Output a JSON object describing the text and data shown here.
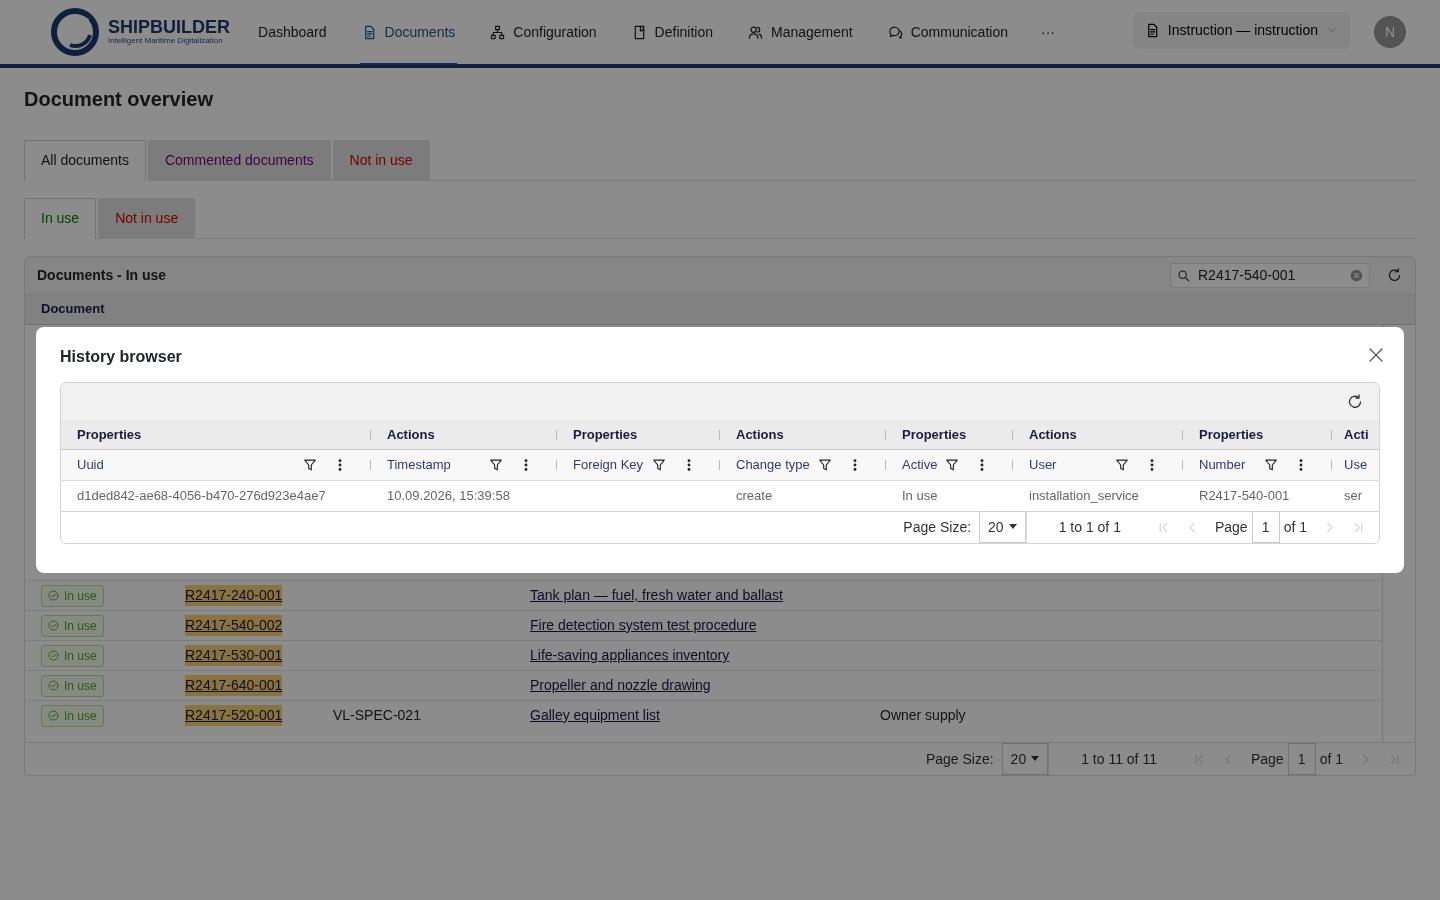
{
  "brand": {
    "name": "SHIPBUILDER",
    "tagline": "Intelligent Maritime Digitalization"
  },
  "nav": [
    {
      "label": "Dashboard",
      "selected": false
    },
    {
      "label": "Documents",
      "selected": true
    },
    {
      "label": "Configuration",
      "selected": false
    },
    {
      "label": "Definition",
      "selected": false
    },
    {
      "label": "Management",
      "selected": false
    },
    {
      "label": "Communication",
      "selected": false
    }
  ],
  "nav_more": "···",
  "context_selector": {
    "label": "Instruction — instruction"
  },
  "avatar": {
    "initial": "N"
  },
  "page_title": "Document overview",
  "tabs": [
    {
      "label": "All documents",
      "selected": true,
      "kind": "all"
    },
    {
      "label": "Commented documents",
      "selected": false,
      "kind": "commented"
    },
    {
      "label": "Not in use",
      "selected": false,
      "kind": "inactive"
    }
  ],
  "subtabs": [
    {
      "label": "In use",
      "selected": true,
      "kind": "active"
    },
    {
      "label": "Not in use",
      "selected": false,
      "kind": "inactive"
    }
  ],
  "documents": {
    "title": "Documents - In use",
    "search": {
      "value": "R2417-540-001"
    },
    "column": "Document",
    "rows": [
      {
        "status": "In use",
        "number": "R2417-240-001",
        "match": true,
        "title": "Tank plan — fuel, fresh water and ballast"
      },
      {
        "status": "In use",
        "number": "R2417-540-002",
        "match": true,
        "title": "Fire detection system test procedure"
      },
      {
        "status": "In use",
        "number": "R2417-530-001",
        "match": true,
        "title": "Life-saving appliances inventory"
      },
      {
        "status": "In use",
        "number": "R2417-640-001",
        "match": true,
        "title": "Propeller and nozzle drawing"
      },
      {
        "status": "In use",
        "number": "R2417-520-001",
        "match": true,
        "code": "VL-SPEC-021",
        "title": "Galley equipment list",
        "column_5": "Owner supply"
      }
    ],
    "pagination": {
      "size_label": "Page Size:",
      "size": "20",
      "range": "1 to 11 of 11",
      "page_label": "Page",
      "page": "1",
      "of": "of 1"
    }
  },
  "modal": {
    "title": "History browser",
    "groups": [
      "Properties",
      "Actions",
      "Properties",
      "Actions",
      "Properties",
      "Actions",
      "Properties",
      "Acti"
    ],
    "columns": [
      "Uuid",
      "Timestamp",
      "Foreign Key",
      "Change type",
      "Active",
      "User",
      "Number",
      "Use"
    ],
    "rows": [
      [
        "d1ded842-ae68-4056-b470-276d923e4ae7",
        "10.09.2026, 15:39:58",
        "",
        "create",
        "In use",
        "installation_service",
        "R2417-540-001",
        "ser"
      ]
    ],
    "pagination": {
      "size_label": "Page Size:",
      "size": "20",
      "range": "1 to 1 of 1",
      "page_label": "Page",
      "page": "1",
      "of": "of 1"
    }
  }
}
